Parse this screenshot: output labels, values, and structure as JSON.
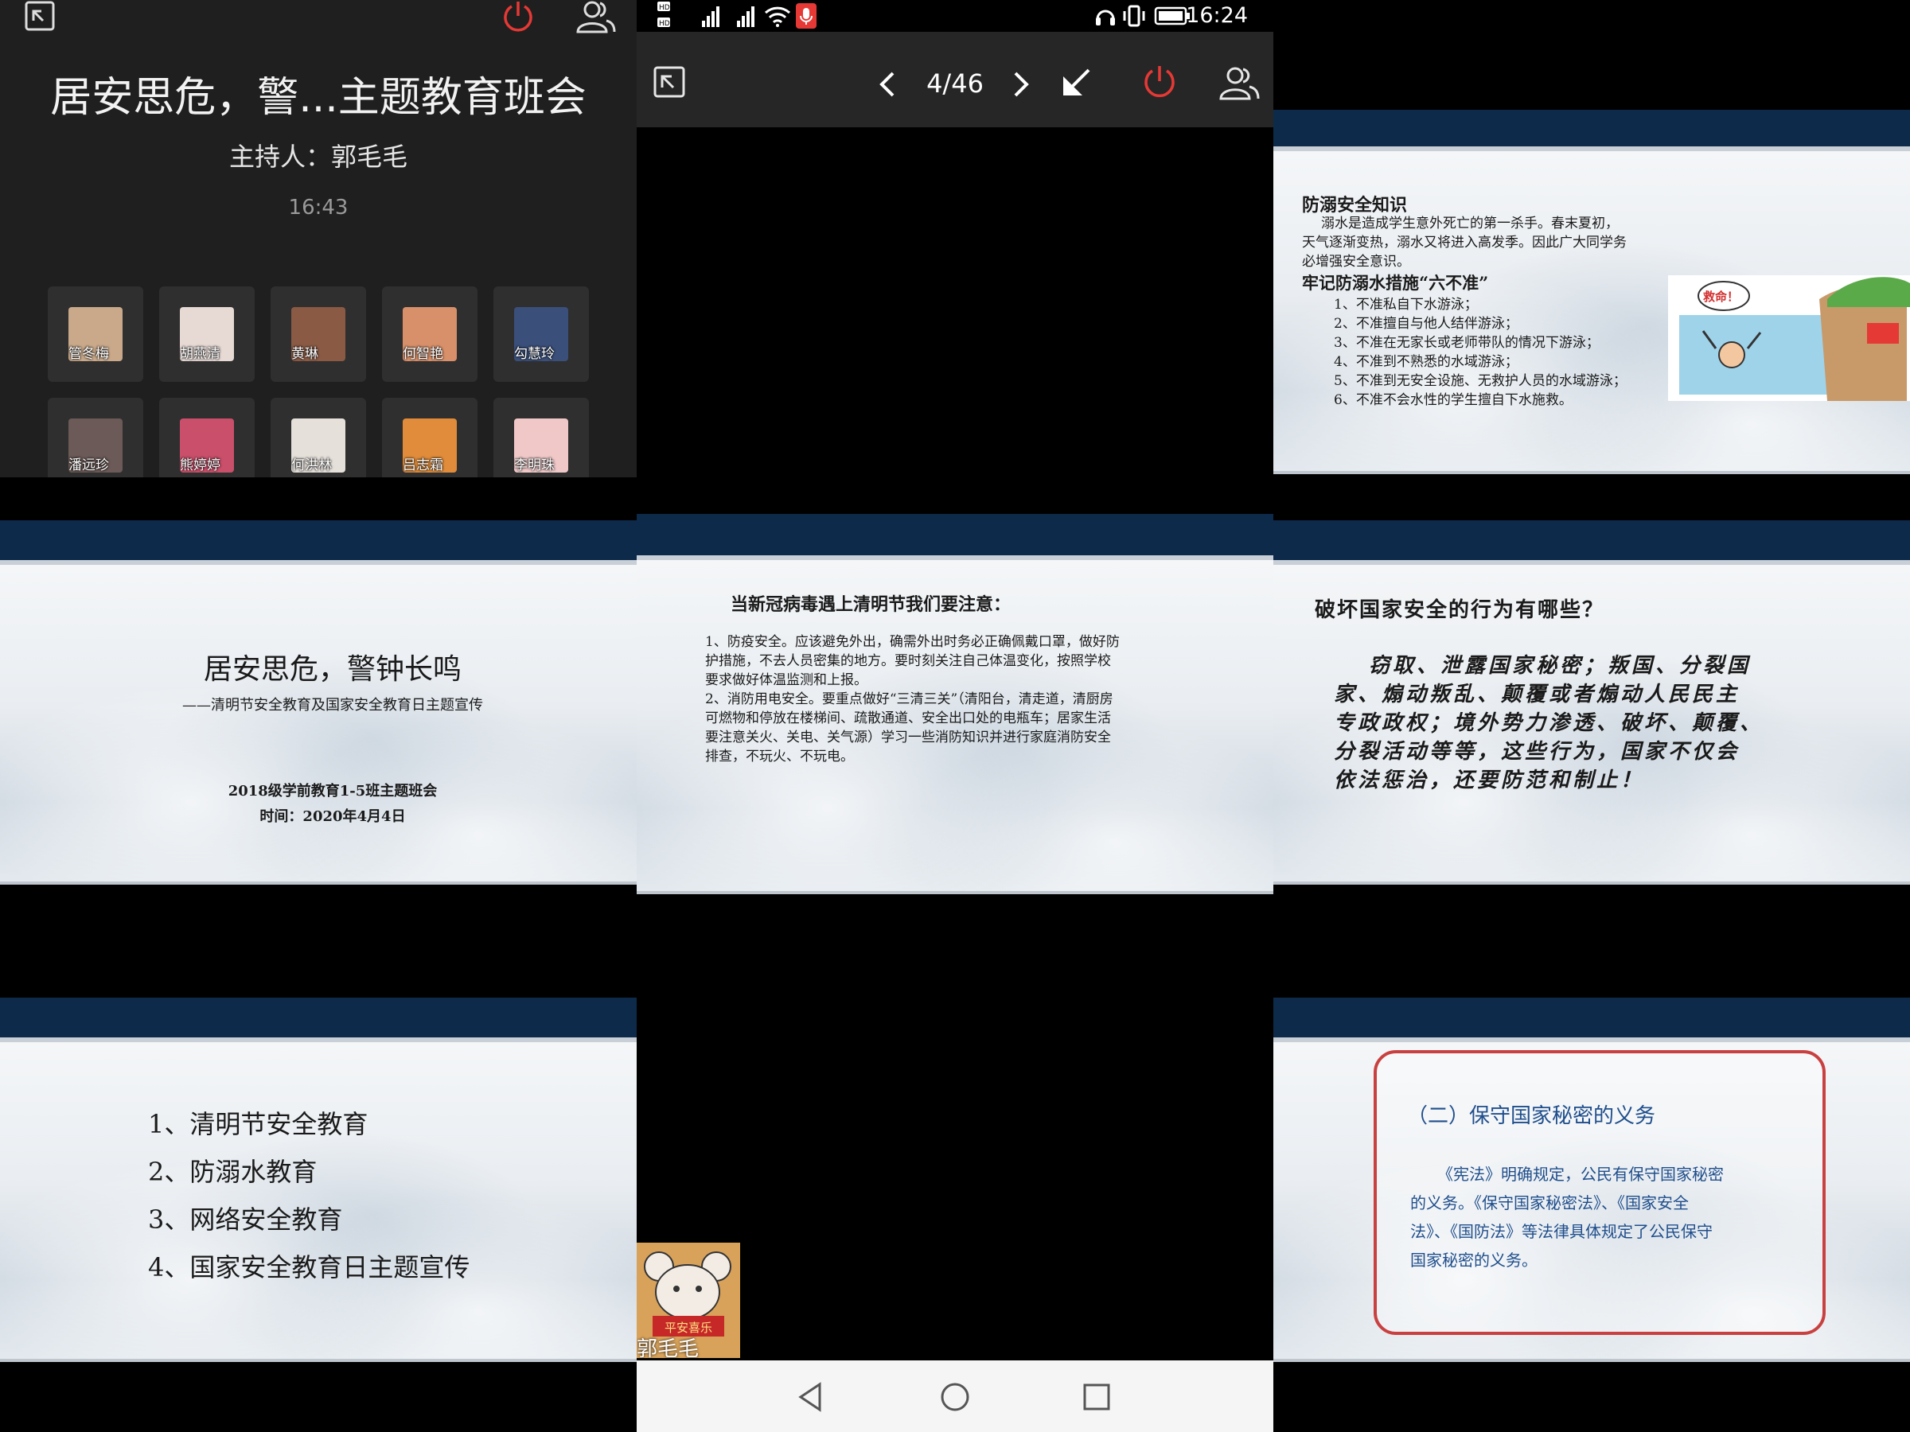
{
  "meeting": {
    "title": "居安思危，警...主题教育班会",
    "host": "主持人：郭毛毛",
    "time": "16:43",
    "participants": [
      {
        "name": "管冬梅",
        "color": "#c9a98a"
      },
      {
        "name": "胡燕清",
        "color": "#e7d9d4"
      },
      {
        "name": "黄琳",
        "color": "#8a5a44"
      },
      {
        "name": "何智艳",
        "color": "#d8906a"
      },
      {
        "name": "勾慧玲",
        "color": "#3a4f7a"
      },
      {
        "name": "潘远珍",
        "color": "#6b5a57"
      },
      {
        "name": "熊婷婷",
        "color": "#c94f6a"
      },
      {
        "name": "何洪林",
        "color": "#e6e0da"
      },
      {
        "name": "吕志霜",
        "color": "#e08c3a"
      },
      {
        "name": "李明珠",
        "color": "#f0c8c8"
      }
    ]
  },
  "phone": {
    "clock": "16:24",
    "page_indicator": "4/46",
    "self_name": "郭毛毛",
    "self_badge": "平安喜乐"
  },
  "slides": {
    "drowning": {
      "heading": "防溺安全知识",
      "intro": [
        "溺水是造成学生意外死亡的第一杀手。春末夏初，",
        "天气逐渐变热，溺水又将进入高发季。因此广大同学务",
        "必增强安全意识。"
      ],
      "sub": "牢记防溺水措施“六不准”",
      "items": [
        "1、不准私自下水游泳；",
        "2、不准擅自与他人结伴游泳；",
        "3、不准在无家长或老师带队的情况下游泳；",
        "4、不准到不熟悉的水域游泳；",
        "5、不准到无安全设施、无救护人员的水域游泳；",
        "6、不准不会水性的学生擅自下水施救。"
      ],
      "bubble": "救命！"
    },
    "cover": {
      "title": "居安思危，警钟长鸣",
      "subtitle": "——清明节安全教育及国家安全教育日主题宣传",
      "class_line": "2018级学前教育1-5班主题班会",
      "date_line": "时间：2020年4月4日"
    },
    "covid": {
      "heading": "当新冠病毒遇上清明节我们要注意：",
      "lines": [
        "1、防疫安全。应该避免外出，确需外出时务必正确佩戴口罩，做好防",
        "护措施，不去人员密集的地方。要时刻关注自己体温变化，按照学校",
        "要求做好体温监测和上报。",
        "2、消防用电安全。要重点做好“三清三关”（清阳台，清走道，清厨房",
        "可燃物和停放在楼梯间、疏散通道、安全出口处的电瓶车；居家生活",
        "要注意关火、关电、关气源）学习一些消防知识并进行家庭消防安全",
        "排查，不玩火、不玩电。"
      ]
    },
    "security": {
      "heading": "破坏国家安全的行为有哪些？",
      "lines": [
        "窃取、泄露国家秘密；叛国、分裂国",
        "家、煽动叛乱、颠覆或者煽动人民民主",
        "专政政权；境外势力渗透、破坏、颠覆、",
        "分裂活动等等，这些行为，国家不仅会",
        "依法惩治，还要防范和制止！"
      ]
    },
    "agenda": {
      "items": [
        "1、清明节安全教育",
        "2、防溺水教育",
        "3、网络安全教育",
        "4、国家安全教育日主题宣传"
      ]
    },
    "secrets": {
      "heading": "（二）保守国家秘密的义务",
      "lines": [
        "《宪法》明确规定，公民有保守国家秘密",
        "的义务。《保守国家秘密法》、《国家安全",
        "法》、《国防法》等法律具体规定了公民保守",
        "国家秘密的义务。"
      ]
    }
  },
  "colors": {
    "band": "#0d2a4a",
    "power": "#e53935",
    "mic": "#e53935",
    "box_border": "#c94040"
  }
}
